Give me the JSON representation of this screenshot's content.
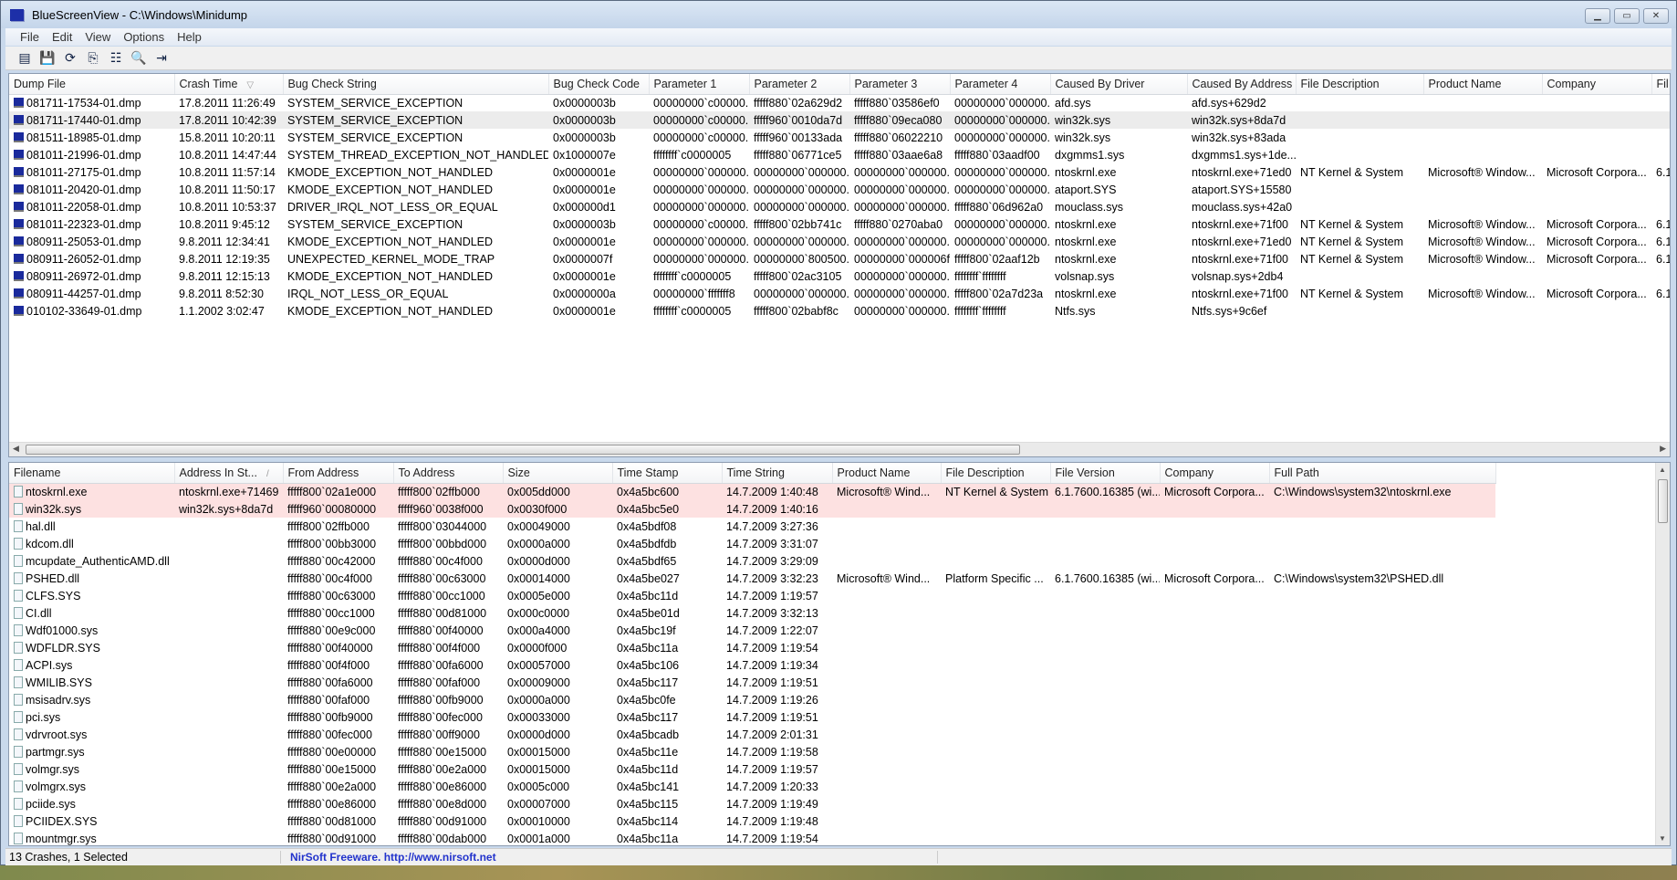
{
  "window": {
    "title": "BlueScreenView  -  C:\\Windows\\Minidump",
    "minimize": "▁",
    "maximize": "▭",
    "close": "✕"
  },
  "menu": [
    "File",
    "Edit",
    "View",
    "Options",
    "Help"
  ],
  "toolbar": [
    {
      "icon": "html-report-icon",
      "glyph": "▤"
    },
    {
      "icon": "save-icon",
      "glyph": "💾"
    },
    {
      "icon": "refresh-icon",
      "glyph": "⟳"
    },
    {
      "icon": "copy-icon",
      "glyph": "⎘"
    },
    {
      "icon": "properties-icon",
      "glyph": "☷"
    },
    {
      "icon": "find-icon",
      "glyph": "🔍"
    },
    {
      "icon": "exit-icon",
      "glyph": "⇥"
    }
  ],
  "crashes": {
    "columns": [
      "Dump File",
      "Crash Time",
      "Bug Check String",
      "Bug Check Code",
      "Parameter 1",
      "Parameter 2",
      "Parameter 3",
      "Parameter 4",
      "Caused By Driver",
      "Caused By Address",
      "File Description",
      "Product Name",
      "Company",
      "Fil"
    ],
    "sort_indicator": "▽",
    "selected_index": 1,
    "rows": [
      [
        "081711-17534-01.dmp",
        "17.8.2011 11:26:49",
        "SYSTEM_SERVICE_EXCEPTION",
        "0x0000003b",
        "00000000`c00000...",
        "fffff880`02a629d2",
        "fffff880`03586ef0",
        "00000000`000000...",
        "afd.sys",
        "afd.sys+629d2",
        "",
        "",
        "",
        ""
      ],
      [
        "081711-17440-01.dmp",
        "17.8.2011 10:42:39",
        "SYSTEM_SERVICE_EXCEPTION",
        "0x0000003b",
        "00000000`c00000...",
        "fffff960`0010da7d",
        "fffff880`09eca080",
        "00000000`000000...",
        "win32k.sys",
        "win32k.sys+8da7d",
        "",
        "",
        "",
        ""
      ],
      [
        "081511-18985-01.dmp",
        "15.8.2011 10:20:11",
        "SYSTEM_SERVICE_EXCEPTION",
        "0x0000003b",
        "00000000`c00000...",
        "fffff960`00133ada",
        "fffff880`06022210",
        "00000000`000000...",
        "win32k.sys",
        "win32k.sys+83ada",
        "",
        "",
        "",
        ""
      ],
      [
        "081011-21996-01.dmp",
        "10.8.2011 14:47:44",
        "SYSTEM_THREAD_EXCEPTION_NOT_HANDLED",
        "0x1000007e",
        "ffffffff`c0000005",
        "fffff880`06771ce5",
        "fffff880`03aae6a8",
        "fffff880`03aadf00",
        "dxgmms1.sys",
        "dxgmms1.sys+1de...",
        "",
        "",
        "",
        ""
      ],
      [
        "081011-27175-01.dmp",
        "10.8.2011 11:57:14",
        "KMODE_EXCEPTION_NOT_HANDLED",
        "0x0000001e",
        "00000000`000000...",
        "00000000`000000...",
        "00000000`000000...",
        "00000000`000000...",
        "ntoskrnl.exe",
        "ntoskrnl.exe+71ed0",
        "NT Kernel & System",
        "Microsoft® Window...",
        "Microsoft Corpora...",
        "6.1"
      ],
      [
        "081011-20420-01.dmp",
        "10.8.2011 11:50:17",
        "KMODE_EXCEPTION_NOT_HANDLED",
        "0x0000001e",
        "00000000`000000...",
        "00000000`000000...",
        "00000000`000000...",
        "00000000`000000...",
        "ataport.SYS",
        "ataport.SYS+15580",
        "",
        "",
        "",
        ""
      ],
      [
        "081011-22058-01.dmp",
        "10.8.2011 10:53:37",
        "DRIVER_IRQL_NOT_LESS_OR_EQUAL",
        "0x000000d1",
        "00000000`000000...",
        "00000000`000000...",
        "00000000`000000...",
        "fffff880`06d962a0",
        "mouclass.sys",
        "mouclass.sys+42a0",
        "",
        "",
        "",
        ""
      ],
      [
        "081011-22323-01.dmp",
        "10.8.2011 9:45:12",
        "SYSTEM_SERVICE_EXCEPTION",
        "0x0000003b",
        "00000000`c00000...",
        "fffff800`02bb741c",
        "fffff880`0270aba0",
        "00000000`000000...",
        "ntoskrnl.exe",
        "ntoskrnl.exe+71f00",
        "NT Kernel & System",
        "Microsoft® Window...",
        "Microsoft Corpora...",
        "6.1"
      ],
      [
        "080911-25053-01.dmp",
        "9.8.2011 12:34:41",
        "KMODE_EXCEPTION_NOT_HANDLED",
        "0x0000001e",
        "00000000`000000...",
        "00000000`000000...",
        "00000000`000000...",
        "00000000`000000...",
        "ntoskrnl.exe",
        "ntoskrnl.exe+71ed0",
        "NT Kernel & System",
        "Microsoft® Window...",
        "Microsoft Corpora...",
        "6.1"
      ],
      [
        "080911-26052-01.dmp",
        "9.8.2011 12:19:35",
        "UNEXPECTED_KERNEL_MODE_TRAP",
        "0x0000007f",
        "00000000`000000...",
        "00000000`800500...",
        "00000000`000006f8",
        "fffff800`02aaf12b",
        "ntoskrnl.exe",
        "ntoskrnl.exe+71f00",
        "NT Kernel & System",
        "Microsoft® Window...",
        "Microsoft Corpora...",
        "6.1"
      ],
      [
        "080911-26972-01.dmp",
        "9.8.2011 12:15:13",
        "KMODE_EXCEPTION_NOT_HANDLED",
        "0x0000001e",
        "ffffffff`c0000005",
        "fffff800`02ac3105",
        "00000000`000000...",
        "ffffffff`ffffffff",
        "volsnap.sys",
        "volsnap.sys+2db4",
        "",
        "",
        "",
        ""
      ],
      [
        "080911-44257-01.dmp",
        "9.8.2011 8:52:30",
        "IRQL_NOT_LESS_OR_EQUAL",
        "0x0000000a",
        "00000000`fffffff8",
        "00000000`000000...",
        "00000000`000000...",
        "fffff800`02a7d23a",
        "ntoskrnl.exe",
        "ntoskrnl.exe+71f00",
        "NT Kernel & System",
        "Microsoft® Window...",
        "Microsoft Corpora...",
        "6.1"
      ],
      [
        "010102-33649-01.dmp",
        "1.1.2002 3:02:47",
        "KMODE_EXCEPTION_NOT_HANDLED",
        "0x0000001e",
        "ffffffff`c0000005",
        "fffff800`02babf8c",
        "00000000`000000...",
        "ffffffff`ffffffff",
        "Ntfs.sys",
        "Ntfs.sys+9c6ef",
        "",
        "",
        "",
        ""
      ]
    ]
  },
  "drivers": {
    "columns": [
      "Filename",
      "Address In St...",
      "From Address",
      "To Address",
      "Size",
      "Time Stamp",
      "Time String",
      "Product Name",
      "File Description",
      "File Version",
      "Company",
      "Full Path"
    ],
    "sort_indicator": "/",
    "highlight_color": "#fde1e1",
    "highlighted": [
      0,
      1
    ],
    "rows": [
      [
        "ntoskrnl.exe",
        "ntoskrnl.exe+71469",
        "fffff800`02a1e000",
        "fffff800`02ffb000",
        "0x005dd000",
        "0x4a5bc600",
        "14.7.2009 1:40:48",
        "Microsoft® Wind...",
        "NT Kernel & System",
        "6.1.7600.16385 (wi...",
        "Microsoft Corpora...",
        "C:\\Windows\\system32\\ntoskrnl.exe"
      ],
      [
        "win32k.sys",
        "win32k.sys+8da7d",
        "fffff960`00080000",
        "fffff960`0038f000",
        "0x0030f000",
        "0x4a5bc5e0",
        "14.7.2009 1:40:16",
        "",
        "",
        "",
        "",
        ""
      ],
      [
        "hal.dll",
        "",
        "fffff800`02ffb000",
        "fffff800`03044000",
        "0x00049000",
        "0x4a5bdf08",
        "14.7.2009 3:27:36",
        "",
        "",
        "",
        "",
        ""
      ],
      [
        "kdcom.dll",
        "",
        "fffff800`00bb3000",
        "fffff800`00bbd000",
        "0x0000a000",
        "0x4a5bdfdb",
        "14.7.2009 3:31:07",
        "",
        "",
        "",
        "",
        ""
      ],
      [
        "mcupdate_AuthenticAMD.dll",
        "",
        "fffff880`00c42000",
        "fffff880`00c4f000",
        "0x0000d000",
        "0x4a5bdf65",
        "14.7.2009 3:29:09",
        "",
        "",
        "",
        "",
        ""
      ],
      [
        "PSHED.dll",
        "",
        "fffff880`00c4f000",
        "fffff880`00c63000",
        "0x00014000",
        "0x4a5be027",
        "14.7.2009 3:32:23",
        "Microsoft® Wind...",
        "Platform Specific ...",
        "6.1.7600.16385 (wi...",
        "Microsoft Corpora...",
        "C:\\Windows\\system32\\PSHED.dll"
      ],
      [
        "CLFS.SYS",
        "",
        "fffff880`00c63000",
        "fffff880`00cc1000",
        "0x0005e000",
        "0x4a5bc11d",
        "14.7.2009 1:19:57",
        "",
        "",
        "",
        "",
        ""
      ],
      [
        "CI.dll",
        "",
        "fffff880`00cc1000",
        "fffff880`00d81000",
        "0x000c0000",
        "0x4a5be01d",
        "14.7.2009 3:32:13",
        "",
        "",
        "",
        "",
        ""
      ],
      [
        "Wdf01000.sys",
        "",
        "fffff880`00e9c000",
        "fffff880`00f40000",
        "0x000a4000",
        "0x4a5bc19f",
        "14.7.2009 1:22:07",
        "",
        "",
        "",
        "",
        ""
      ],
      [
        "WDFLDR.SYS",
        "",
        "fffff880`00f40000",
        "fffff880`00f4f000",
        "0x0000f000",
        "0x4a5bc11a",
        "14.7.2009 1:19:54",
        "",
        "",
        "",
        "",
        ""
      ],
      [
        "ACPI.sys",
        "",
        "fffff880`00f4f000",
        "fffff880`00fa6000",
        "0x00057000",
        "0x4a5bc106",
        "14.7.2009 1:19:34",
        "",
        "",
        "",
        "",
        ""
      ],
      [
        "WMILIB.SYS",
        "",
        "fffff880`00fa6000",
        "fffff880`00faf000",
        "0x00009000",
        "0x4a5bc117",
        "14.7.2009 1:19:51",
        "",
        "",
        "",
        "",
        ""
      ],
      [
        "msisadrv.sys",
        "",
        "fffff880`00faf000",
        "fffff880`00fb9000",
        "0x0000a000",
        "0x4a5bc0fe",
        "14.7.2009 1:19:26",
        "",
        "",
        "",
        "",
        ""
      ],
      [
        "pci.sys",
        "",
        "fffff880`00fb9000",
        "fffff880`00fec000",
        "0x00033000",
        "0x4a5bc117",
        "14.7.2009 1:19:51",
        "",
        "",
        "",
        "",
        ""
      ],
      [
        "vdrvroot.sys",
        "",
        "fffff880`00fec000",
        "fffff880`00ff9000",
        "0x0000d000",
        "0x4a5bcadb",
        "14.7.2009 2:01:31",
        "",
        "",
        "",
        "",
        ""
      ],
      [
        "partmgr.sys",
        "",
        "fffff880`00e00000",
        "fffff880`00e15000",
        "0x00015000",
        "0x4a5bc11e",
        "14.7.2009 1:19:58",
        "",
        "",
        "",
        "",
        ""
      ],
      [
        "volmgr.sys",
        "",
        "fffff880`00e15000",
        "fffff880`00e2a000",
        "0x00015000",
        "0x4a5bc11d",
        "14.7.2009 1:19:57",
        "",
        "",
        "",
        "",
        ""
      ],
      [
        "volmgrx.sys",
        "",
        "fffff880`00e2a000",
        "fffff880`00e86000",
        "0x0005c000",
        "0x4a5bc141",
        "14.7.2009 1:20:33",
        "",
        "",
        "",
        "",
        ""
      ],
      [
        "pciide.sys",
        "",
        "fffff880`00e86000",
        "fffff880`00e8d000",
        "0x00007000",
        "0x4a5bc115",
        "14.7.2009 1:19:49",
        "",
        "",
        "",
        "",
        ""
      ],
      [
        "PCIIDEX.SYS",
        "",
        "fffff880`00d81000",
        "fffff880`00d91000",
        "0x00010000",
        "0x4a5bc114",
        "14.7.2009 1:19:48",
        "",
        "",
        "",
        "",
        ""
      ],
      [
        "mountmgr.sys",
        "",
        "fffff880`00d91000",
        "fffff880`00dab000",
        "0x0001a000",
        "0x4a5bc11a",
        "14.7.2009 1:19:54",
        "",
        "",
        "",
        "",
        ""
      ]
    ]
  },
  "status": {
    "count": "13 Crashes, 1 Selected",
    "credit": "NirSoft Freeware.  http://www.nirsoft.net"
  }
}
